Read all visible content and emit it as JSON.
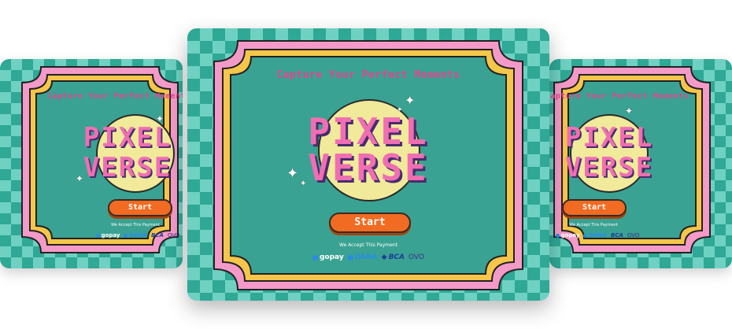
{
  "title": "Capture Your Perfect Moments",
  "logo": {
    "line1": "PIXEL",
    "line2": "VERSE"
  },
  "start_label": "Start",
  "payment_caption": "We Accept This Payment",
  "payments": {
    "gopay": "gopay",
    "dana": "DANA",
    "bca": "BCA",
    "ovo": "OVO"
  },
  "colors": {
    "teal": "#2fa896",
    "pink": "#f49ac8",
    "yellow": "#f6c64a",
    "orange": "#f26b22",
    "magenta": "#e2458f"
  },
  "icons": [
    "sparkle-icon",
    "gopay-icon",
    "dana-icon",
    "bca-icon"
  ]
}
